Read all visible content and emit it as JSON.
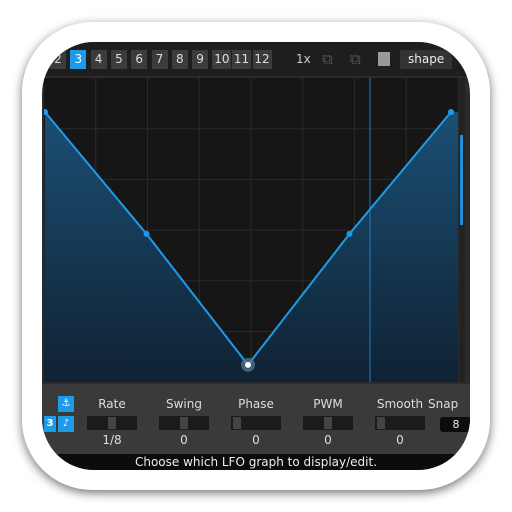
{
  "toolbar": {
    "tabs": [
      "2",
      "3",
      "4",
      "5",
      "6",
      "7",
      "8",
      "9",
      "10",
      "11",
      "12"
    ],
    "selected_tab": "3",
    "multiplier": "1x",
    "shape_label": "shape"
  },
  "graph": {
    "points": [
      [
        0,
        1
      ],
      [
        0.25,
        0.55
      ],
      [
        0.5,
        0.05
      ],
      [
        0.75,
        0.55
      ],
      [
        1,
        1
      ]
    ],
    "accent": "#1e9be8"
  },
  "controls": [
    {
      "label": "Rate",
      "value": "1/8",
      "knob": 0.5
    },
    {
      "label": "Swing",
      "value": "0",
      "knob": 0.5
    },
    {
      "label": "Phase",
      "value": "0",
      "knob": 0
    },
    {
      "label": "PWM",
      "value": "0",
      "knob": 0.5
    },
    {
      "label": "Smooth",
      "value": "0",
      "knob": 0
    }
  ],
  "snap": {
    "label": "Snap",
    "value": "8"
  },
  "graph_badge": "3",
  "status": "Choose which LFO graph to display/edit."
}
